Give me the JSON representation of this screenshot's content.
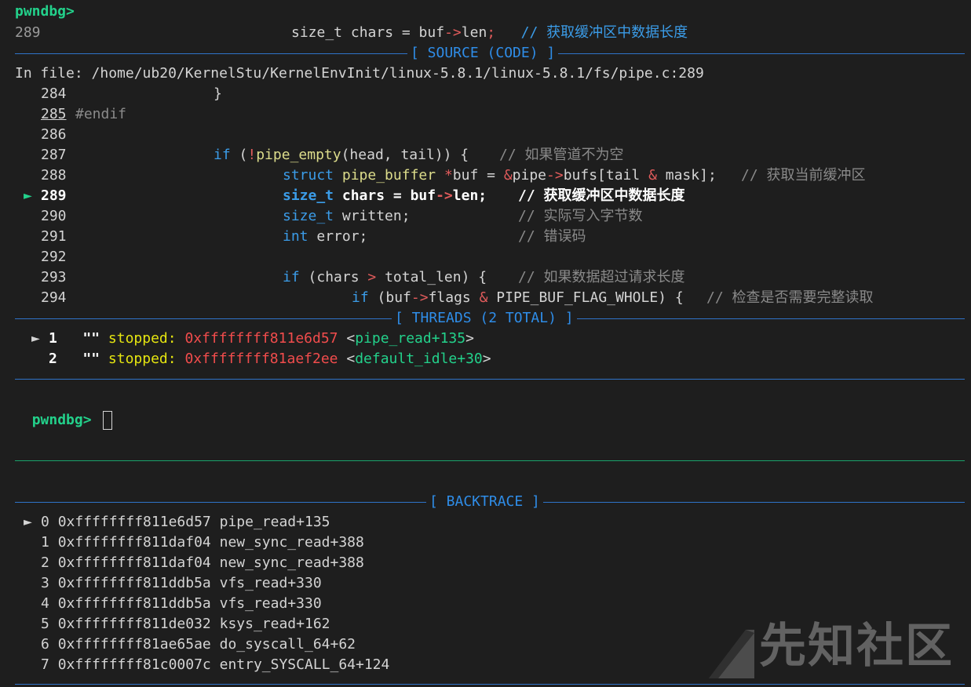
{
  "prompt": "pwndbg>",
  "top_line": {
    "num": "289",
    "code": "size_t chars = buf->len;",
    "comment": "// 获取缓冲区中数据长度"
  },
  "source_header": "[ SOURCE (CODE) ]",
  "in_file": "In file: /home/ub20/KernelStu/KernelEnvInit/linux-5.8.1/linux-5.8.1/fs/pipe.c:289",
  "source_lines": [
    {
      "num": "284",
      "text": "}"
    },
    {
      "num": "285",
      "text": "#endif"
    },
    {
      "num": "286",
      "text": ""
    },
    {
      "num": "287",
      "text": "if (!pipe_empty(head, tail)) {",
      "comment": "// 如果管道不为空"
    },
    {
      "num": "288",
      "text": "struct pipe_buffer *buf = &pipe->bufs[tail & mask];",
      "comment": "// 获取当前缓冲区"
    },
    {
      "num": "289",
      "text": "size_t chars = buf->len;",
      "comment": "// 获取缓冲区中数据长度"
    },
    {
      "num": "290",
      "text": "size_t written;",
      "comment": "// 实际写入字节数"
    },
    {
      "num": "291",
      "text": "int error;",
      "comment": "// 错误码"
    },
    {
      "num": "292",
      "text": ""
    },
    {
      "num": "293",
      "text": "if (chars > total_len) {",
      "comment": "// 如果数据超过请求长度"
    },
    {
      "num": "294",
      "text": "if (buf->flags & PIPE_BUF_FLAG_WHOLE) {",
      "comment": "// 检查是否需要完整读取"
    }
  ],
  "threads_header": "[ THREADS (2 TOTAL) ]",
  "threads": [
    {
      "marker": "►",
      "id": "1",
      "name": "\"\"",
      "state": "stopped:",
      "addr": "0xffffffff811e6d57",
      "sym": "<pipe_read+135>"
    },
    {
      "marker": "",
      "id": "2",
      "name": "\"\"",
      "state": "stopped:",
      "addr": "0xffffffff81aef2ee",
      "sym": "<default_idle+30>"
    }
  ],
  "backtrace_header": "[ BACKTRACE ]",
  "backtrace": [
    {
      "marker": "►",
      "idx": "0",
      "addr": "0xffffffff811e6d57",
      "sym": "pipe_read+135"
    },
    {
      "marker": "",
      "idx": "1",
      "addr": "0xffffffff811daf04",
      "sym": "new_sync_read+388"
    },
    {
      "marker": "",
      "idx": "2",
      "addr": "0xffffffff811daf04",
      "sym": "new_sync_read+388"
    },
    {
      "marker": "",
      "idx": "3",
      "addr": "0xffffffff811ddb5a",
      "sym": "vfs_read+330"
    },
    {
      "marker": "",
      "idx": "4",
      "addr": "0xffffffff811ddb5a",
      "sym": "vfs_read+330"
    },
    {
      "marker": "",
      "idx": "5",
      "addr": "0xffffffff811de032",
      "sym": "ksys_read+162"
    },
    {
      "marker": "",
      "idx": "6",
      "addr": "0xffffffff81ae65ae",
      "sym": "do_syscall_64+62"
    },
    {
      "marker": "",
      "idx": "7",
      "addr": "0xffffffff81c0007c",
      "sym": "entry_SYSCALL_64+124"
    }
  ],
  "watermark": "先知社区",
  "colors": {
    "bg": "#1e1e1e",
    "prompt": "#23d18b",
    "header": "#2f8de8",
    "divider": "#2f73c9",
    "pane_divider": "#1aa36b"
  }
}
